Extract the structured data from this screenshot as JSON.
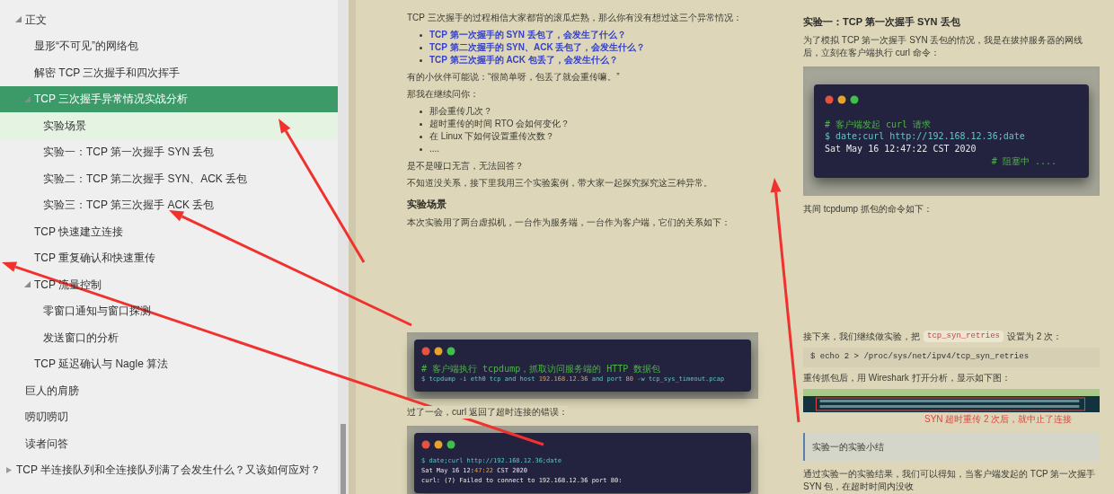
{
  "sidebar": {
    "scrolled_branch": [
      {
        "label": "正文",
        "expanded": true,
        "selected": false,
        "highlighted": false,
        "children": [
          {
            "label": "显形“不可见”的网络包",
            "selected": false,
            "highlighted": false
          },
          {
            "label": "解密 TCP 三次握手和四次挥手",
            "selected": false,
            "highlighted": false
          },
          {
            "label": "TCP 三次握手异常情况实战分析",
            "expanded": true,
            "selected": true,
            "highlighted": false,
            "children": [
              {
                "label": "实验场景",
                "selected": false,
                "highlighted": true
              },
              {
                "label": "实验一：TCP 第一次握手 SYN 丢包",
                "selected": false,
                "highlighted": false
              },
              {
                "label": "实验二：TCP 第二次握手 SYN、ACK 丢包",
                "selected": false,
                "highlighted": false
              },
              {
                "label": "实验三：TCP 第三次握手 ACK 丢包",
                "selected": false,
                "highlighted": false
              }
            ]
          },
          {
            "label": "TCP 快速建立连接",
            "selected": false,
            "highlighted": false
          },
          {
            "label": "TCP 重复确认和快速重传",
            "selected": false,
            "highlighted": false
          },
          {
            "label": "TCP 流量控制",
            "expanded": true,
            "selected": false,
            "highlighted": false,
            "children": [
              {
                "label": "零窗口通知与窗口探测",
                "selected": false,
                "highlighted": false
              },
              {
                "label": "发送窗口的分析",
                "selected": false,
                "highlighted": false
              }
            ]
          },
          {
            "label": "TCP 延迟确认与 Nagle 算法",
            "selected": false,
            "highlighted": false
          }
        ]
      },
      {
        "label": "巨人的肩膀",
        "selected": false,
        "highlighted": false
      },
      {
        "label": "唠叨唠叨",
        "selected": false,
        "highlighted": false
      },
      {
        "label": "读者问答",
        "selected": false,
        "highlighted": false
      }
    ],
    "items": [
      {
        "label": "TCP 半连接队列和全连接队列满了会发生什么？又该如何应对？",
        "expanded": false,
        "selected": false,
        "highlighted": false
      }
    ]
  },
  "pages": [
    {
      "top": [
        {
          "kind": "paragraph",
          "text": "TCP 三次握手的过程相信大家都背的滚瓜烂熟，那么你有没有想过这三个异常情况："
        },
        {
          "kind": "link_list",
          "items": [
            "TCP 第一次握手的 SYN 丢包了，会发生了什么？",
            "TCP 第二次握手的 SYN、ACK 丢包了，会发生什么？",
            "TCP 第三次握手的 ACK 包丢了，会发生什么？"
          ]
        },
        {
          "kind": "paragraph",
          "text": "有的小伙伴可能说：“很简单呀，包丢了就会重传嘛。”"
        },
        {
          "kind": "paragraph",
          "text": "那我在继续问你："
        },
        {
          "kind": "list",
          "items": [
            "那会重传几次？",
            "超时重传的时间 RTO 会如何变化？",
            "在 Linux 下如何设置重传次数？",
            "...."
          ]
        },
        {
          "kind": "paragraph",
          "text": "是不是哑口无言，无法回答？"
        },
        {
          "kind": "paragraph",
          "text": "不知道没关系，接下里我用三个实验案例，带大家一起探究探究这三种异常。"
        },
        {
          "kind": "heading",
          "text": "实验场景"
        },
        {
          "kind": "paragraph",
          "text": "本次实验用了两台虚拟机，一台作为服务端，一台作为客户端，它们的关系如下："
        }
      ],
      "bottom": [
        {
          "kind": "terminal",
          "lines": [
            {
              "kind": "comment",
              "parts": [
                {
                  "text": "# 客户端执行 tcpdump，抓取访问服务端的 HTTP 数据包",
                  "kind": "plain"
                }
              ]
            },
            {
              "kind": "command",
              "parts": [
                {
                  "text": "$ tcpdump -i eth0 tcp and host ",
                  "kind": "plain"
                },
                {
                  "text": "192.168.12.36",
                  "kind": "value"
                },
                {
                  "text": " and port ",
                  "kind": "plain"
                },
                {
                  "text": "80",
                  "kind": "value"
                },
                {
                  "text": " -w tcp_sys_timeout.pcap",
                  "kind": "plain"
                }
              ]
            }
          ]
        },
        {
          "kind": "paragraph",
          "text": "过了一会，curl 返回了超时连接的错误："
        },
        {
          "kind": "terminal",
          "lines": [
            {
              "kind": "command",
              "parts": [
                {
                  "text": "$ date;curl http://192.168.12.36;date",
                  "kind": "plain"
                }
              ]
            },
            {
              "kind": "output",
              "parts": [
                {
                  "text": "Sat May 16 12:",
                  "kind": "plain"
                },
                {
                  "text": "47:22",
                  "kind": "value"
                },
                {
                  "text": " CST 2020",
                  "kind": "plain"
                }
              ]
            },
            {
              "kind": "output",
              "parts": [
                {
                  "text": "curl: (7) Failed to connect to 192.168.12.36 port 80:",
                  "kind": "plain"
                }
              ]
            }
          ]
        }
      ]
    },
    {
      "top": [
        {
          "kind": "heading",
          "text": "实验一：TCP 第一次握手 SYN 丢包"
        },
        {
          "kind": "paragraph",
          "text": "为了模拟 TCP 第一次握手 SYN 丢包的情况，我是在拔掉服务器的网线后，立刻在客户端执行 curl 命令："
        },
        {
          "kind": "terminal",
          "lines": [
            {
              "kind": "comment",
              "parts": [
                {
                  "text": "# 客户端发起 curl 请求",
                  "kind": "plain"
                }
              ]
            },
            {
              "kind": "command",
              "parts": [
                {
                  "text": "$ date;curl http://192.168.12.36;date",
                  "kind": "plain"
                }
              ]
            },
            {
              "kind": "output",
              "parts": [
                {
                  "text": "Sat May 16 12:47:22 CST 2020",
                  "kind": "plain"
                }
              ]
            },
            {
              "kind": "note",
              "parts": [
                {
                  "text": "# 阻塞中 ....",
                  "kind": "plain"
                }
              ]
            }
          ]
        },
        {
          "kind": "paragraph",
          "text": "其间 tcpdump 抓包的命令如下："
        }
      ],
      "bottom": [
        {
          "kind": "code_paragraph",
          "before": "接下来，我们继续做实验，把",
          "code": "tcp_syn_retries",
          "after": "设置为 2 次："
        },
        {
          "kind": "code",
          "text": "$ echo 2 > /proc/sys/net/ipv4/tcp_syn_retries"
        },
        {
          "kind": "paragraph",
          "text": "重传抓包后，用 Wireshark 打开分析，显示如下图："
        },
        {
          "kind": "packets",
          "caption": "SYN 超时重传 2 次后，就中止了连接"
        },
        {
          "kind": "callout",
          "text": "实验一的实验小结"
        },
        {
          "kind": "paragraph",
          "text": "通过实验一的实验结果，我们可以得知，当客户端发起的 TCP 第一次握手 SYN 包，在超时时间内没收"
        }
      ]
    }
  ]
}
